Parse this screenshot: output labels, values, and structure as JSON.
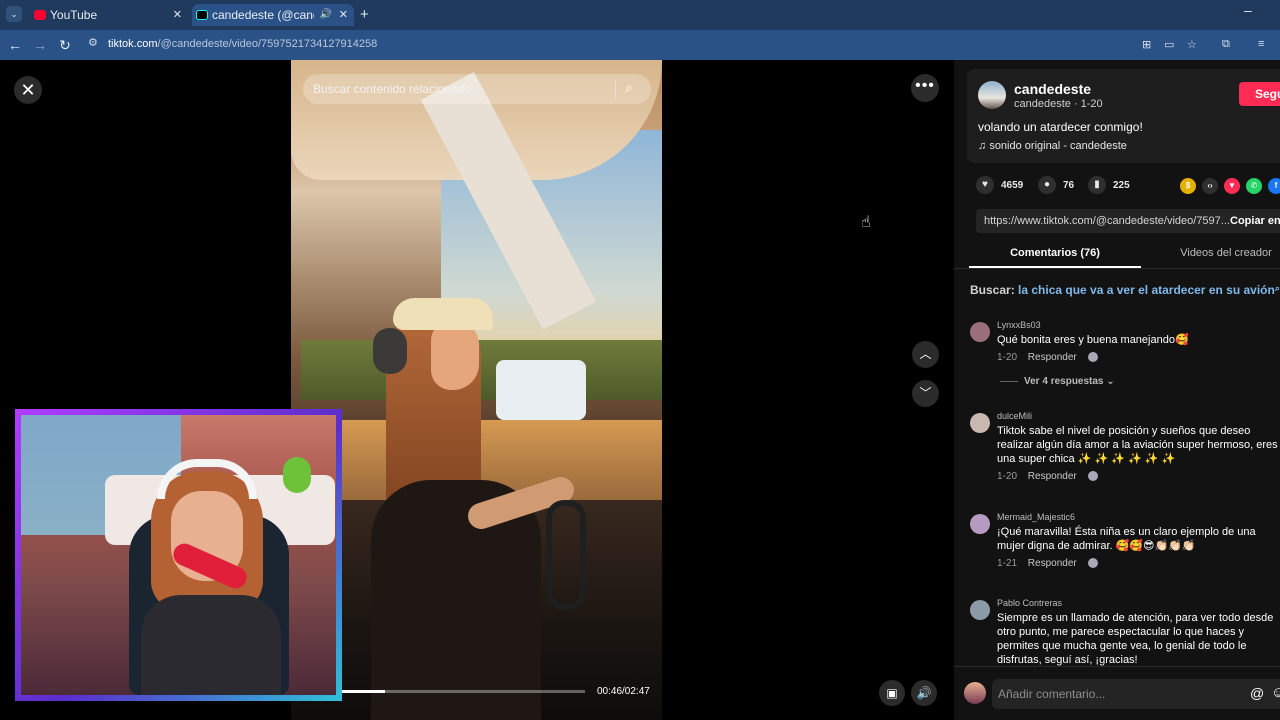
{
  "browser": {
    "tabs": [
      {
        "title": "YouTube",
        "favicon": "youtube-icon"
      },
      {
        "title": "candedeste (@candedeste)",
        "favicon": "tiktok-icon",
        "audio": true
      }
    ],
    "url_domain": "tiktok.com",
    "url_path": "/@candedeste/video/7597521734127914258"
  },
  "video": {
    "search_placeholder": "Buscar contenido relacionado",
    "time": "00:46/02:47",
    "progress_fraction": 0.18
  },
  "author": {
    "name": "candedeste",
    "meta": "candedeste · 1-20",
    "follow_label": "Seguir",
    "caption": "volando un atardecer conmigo!",
    "music": "sonido original - candedeste"
  },
  "stats": {
    "likes": "4659",
    "comments": "76",
    "saves": "225"
  },
  "share": {
    "link": "https://www.tiktok.com/@candedeste/video/7597...",
    "copy_label": "Copiar enlace"
  },
  "panel_tabs": {
    "comments": "Comentarios (76)",
    "creator_videos": "Videos del creador"
  },
  "search_related": {
    "prefix": "Buscar:",
    "query": "la chica que va a ver el atardecer en su avión"
  },
  "comments": [
    {
      "user": "LynxxBs03",
      "text": "Qué bonita eres y buena manejando🥰",
      "date": "1-20",
      "reply": "Responder"
    },
    {
      "user": "dulceMili",
      "text": "Tiktok sabe el nivel de posición y sueños que deseo realizar algún día amor a la aviación super hermoso, eres una super chica ✨ ✨ ✨ ✨ ✨ ✨",
      "date": "1-20",
      "reply": "Responder"
    },
    {
      "user": "Mermaid_Majestic6",
      "text": "¡Qué maravilla! Ésta niña es un claro ejemplo de una mujer digna de admirar. 🥰🥰😎👏🏻👏🏻👏🏻",
      "date": "1-21",
      "reply": "Responder"
    },
    {
      "user": "Pablo Contreras",
      "text": "Siempre es un llamado de atención, para ver todo desde otro punto, me parece espectacular lo que haces y permites que mucha gente vea, lo genial de todo le disfrutas, seguí así, ¡gracias!",
      "date": "",
      "reply": ""
    }
  ],
  "view_replies": "Ver 4 respuestas",
  "comment_input": {
    "placeholder": "Añadir comentario..."
  },
  "colors": {
    "accent": "#fe2c55",
    "link": "#7fb8ea",
    "panel_bg": "#121212"
  }
}
